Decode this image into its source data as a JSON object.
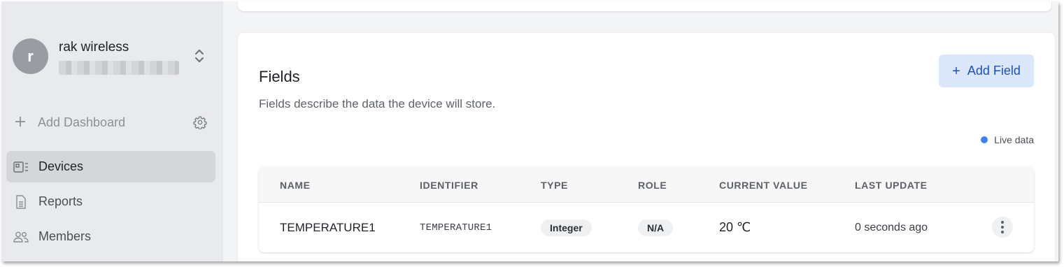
{
  "account": {
    "initial": "r",
    "name": "rak wireless",
    "switcher_icon": "chevron-up-down-icon"
  },
  "sidebar": {
    "add_dashboard": {
      "label": "Add Dashboard",
      "icon": "plus-icon",
      "settings_icon": "gear-icon"
    },
    "items": [
      {
        "label": "Devices",
        "icon": "devices-icon",
        "active": true
      },
      {
        "label": "Reports",
        "icon": "report-icon",
        "active": false
      },
      {
        "label": "Members",
        "icon": "members-icon",
        "active": false
      }
    ]
  },
  "fields_card": {
    "title": "Fields",
    "description": "Fields describe the data the device will store.",
    "add_button": {
      "label": "Add Field",
      "icon": "plus-icon"
    },
    "live_indicator": {
      "label": "Live data",
      "color": "#3b82f6"
    },
    "table": {
      "columns": [
        "NAME",
        "IDENTIFIER",
        "TYPE",
        "ROLE",
        "CURRENT VALUE",
        "LAST UPDATE"
      ],
      "rows": [
        {
          "name": "TEMPERATURE1",
          "identifier": "TEMPERATURE1",
          "type": "Integer",
          "role": "N/A",
          "current_value": "20 ℃",
          "last_update": "0 seconds ago",
          "actions_icon": "kebab-menu-icon"
        }
      ]
    }
  },
  "colors": {
    "accent": "#1f4fbf",
    "accent_bg": "#dbe7fb",
    "sidebar_bg": "#e9eaed",
    "active_item_bg": "#d4d6da"
  }
}
